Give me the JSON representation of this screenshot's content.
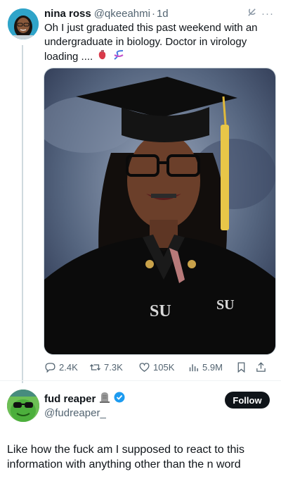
{
  "tweet1": {
    "author_name": "nina ross",
    "handle": "@qkeeahmi",
    "separator": "·",
    "time": "1d",
    "text": "Oh I just graduated this past weekend with an undergraduate in biology.  Doctor in virology loading ....",
    "emojis": [
      "anatomical-heart-emoji",
      "dna-emoji"
    ],
    "image_description_icon": "graduation-portrait",
    "actions": {
      "replies": "2.4K",
      "reposts": "7.3K",
      "likes": "105K",
      "views": "5.9M"
    }
  },
  "tweet2": {
    "author_name": "fud reaper",
    "handle": "@fudreaper_",
    "follow_label": "Follow",
    "text": "Like how the fuck am I supposed to react to this information with anything other than the n word"
  },
  "colors": {
    "text": "#0f1419",
    "secondary": "#536471",
    "verified": "#1d9bf0",
    "follow_bg": "#0f1419"
  }
}
